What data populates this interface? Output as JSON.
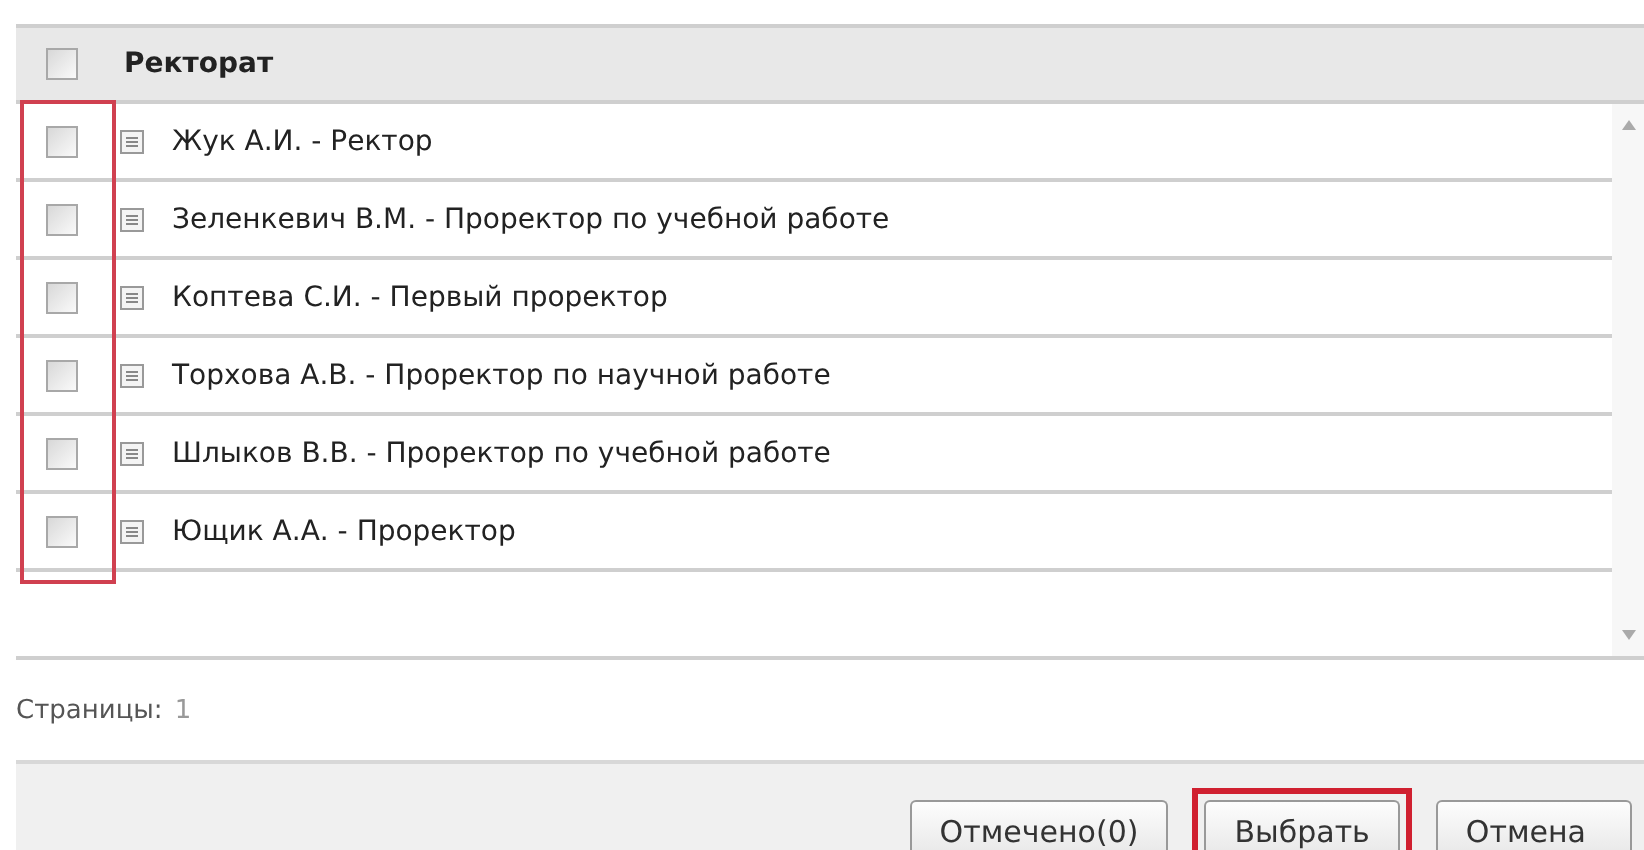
{
  "table": {
    "header": {
      "title": "Ректорат",
      "checked": false
    },
    "checkbox_column_highlighted": true,
    "rows": [
      {
        "text": "Жук А.И. - Ректор",
        "checked": false
      },
      {
        "text": "Зеленкевич В.М. - Проректор по учебной работе",
        "checked": false
      },
      {
        "text": "Коптева С.И. - Первый проректор",
        "checked": false
      },
      {
        "text": "Торхова А.В. - Проректор по научной работе",
        "checked": false
      },
      {
        "text": "Шлыков В.В. - Проректор по учебной работе",
        "checked": false
      },
      {
        "text": "Ющик А.А. - Проректор",
        "checked": false
      }
    ]
  },
  "pager": {
    "label": "Страницы:",
    "pages": [
      "1"
    ]
  },
  "buttons": [
    {
      "label": "Отмечено(0)",
      "highlighted": false
    },
    {
      "label": "Выбрать",
      "highlighted": true
    },
    {
      "label": "Отмена",
      "highlighted": false
    }
  ]
}
